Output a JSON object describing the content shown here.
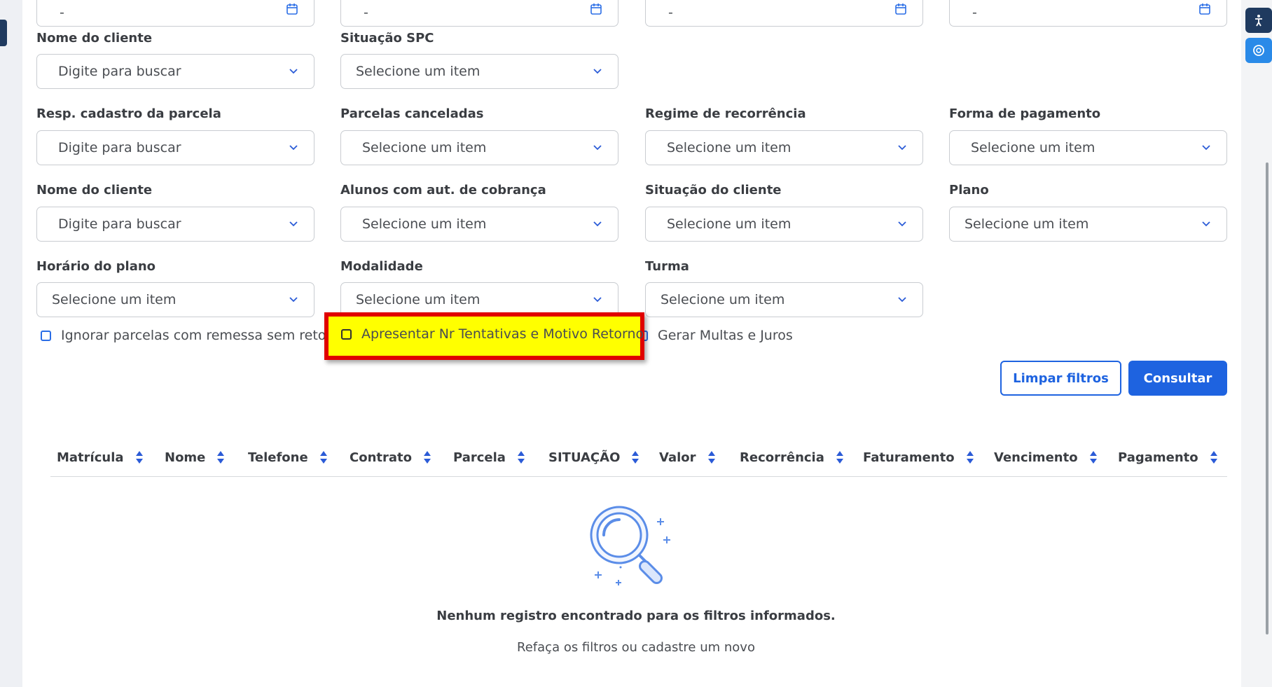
{
  "date_fields": [
    {
      "value": "-"
    },
    {
      "value": "-"
    },
    {
      "value": "-"
    },
    {
      "value": "-"
    }
  ],
  "fields": {
    "nome_cliente_1": {
      "label": "Nome do cliente",
      "value": "Digite para buscar"
    },
    "situacao_spc": {
      "label": "Situação SPC",
      "value": "Selecione um item"
    },
    "resp_cadastro": {
      "label": "Resp. cadastro da parcela",
      "value": "Digite para buscar"
    },
    "parcelas_canceladas": {
      "label": "Parcelas canceladas",
      "value": "Selecione um item"
    },
    "regime_recorrencia": {
      "label": "Regime de recorrência",
      "value": "Selecione um item"
    },
    "forma_pagamento": {
      "label": "Forma de pagamento",
      "value": "Selecione um item"
    },
    "nome_cliente_2": {
      "label": "Nome do cliente",
      "value": "Digite para buscar"
    },
    "alunos_aut_cobranca": {
      "label": "Alunos com aut. de cobrança",
      "value": "Selecione um item"
    },
    "situacao_cliente": {
      "label": "Situação do cliente",
      "value": "Selecione um item"
    },
    "plano": {
      "label": "Plano",
      "value": "Selecione um item"
    },
    "horario_plano": {
      "label": "Horário do plano",
      "value": "Selecione um item"
    },
    "modalidade": {
      "label": "Modalidade",
      "value": "Selecione um item"
    },
    "turma": {
      "label": "Turma",
      "value": "Selecione um item"
    }
  },
  "checkboxes": {
    "ignorar_parcelas": "Ignorar parcelas com remessa sem retorno",
    "apresentar_tentativas": "Apresentar Nr Tentativas e Motivo Retorno",
    "gerar_multas": "Gerar Multas e Juros"
  },
  "buttons": {
    "limpar": "Limpar filtros",
    "consultar": "Consultar"
  },
  "table": {
    "columns": [
      "Matrícula",
      "Nome",
      "Telefone",
      "Contrato",
      "Parcela",
      "SITUAÇÃO",
      "Valor",
      "Recorrência",
      "Faturamento",
      "Vencimento",
      "Pagamento"
    ]
  },
  "empty_state": {
    "title": "Nenhum registro encontrado para os filtros informados.",
    "subtitle": "Refaça os filtros ou cadastre um novo",
    "icon": "magnifier-icon"
  },
  "colors": {
    "primary": "#1e63e0",
    "highlight_fill": "#ffff00",
    "highlight_border": "#e00000"
  }
}
